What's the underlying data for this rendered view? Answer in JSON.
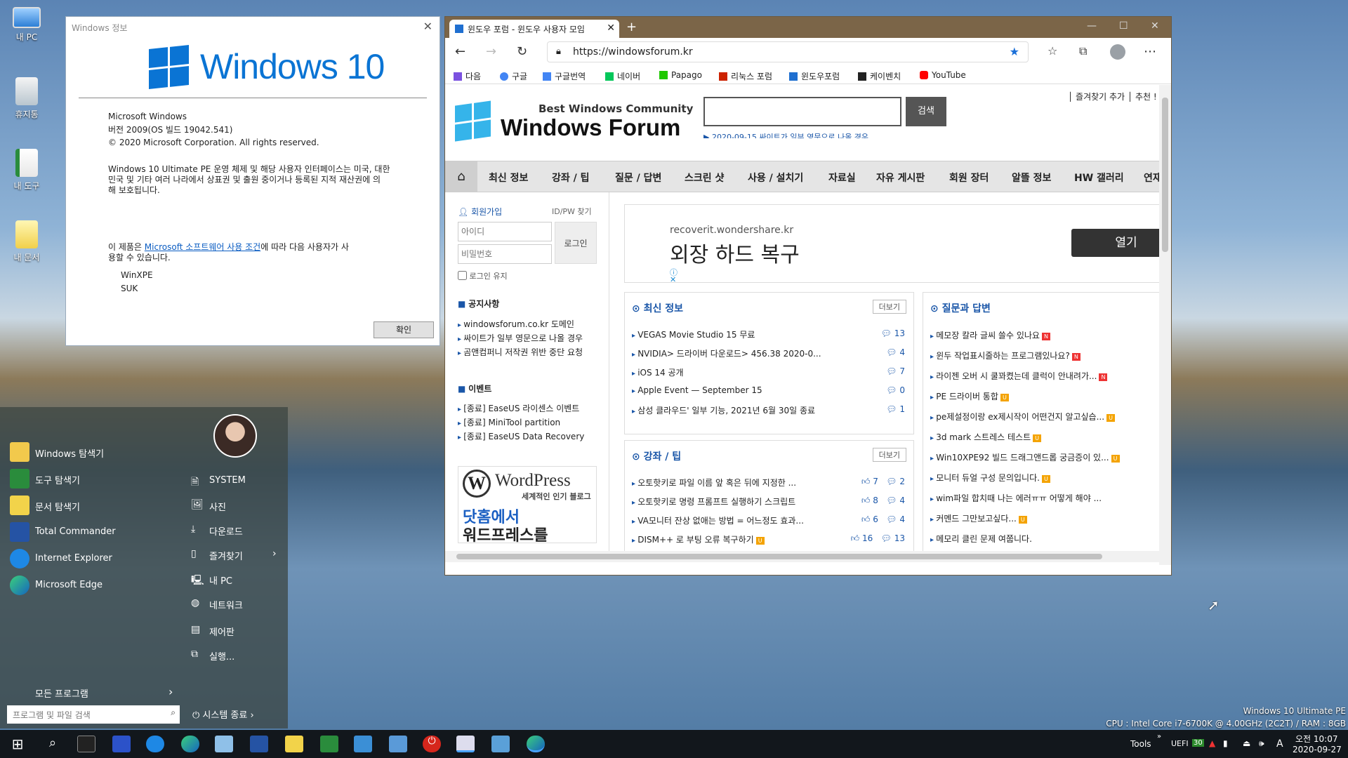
{
  "desktop": {
    "icons": [
      {
        "label": "내 PC",
        "icon": "monitor-icon"
      },
      {
        "label": "휴지통",
        "icon": "recycle-bin-icon"
      },
      {
        "label": "내 도구",
        "icon": "tools-icon"
      },
      {
        "label": "내 문서",
        "icon": "documents-icon"
      }
    ],
    "sysinfo": {
      "line1": "Windows 10 Ultimate PE",
      "line2": "CPU : Intel Core i7-6700K @ 4.00GHz (2C2T) / RAM : 8GB"
    }
  },
  "about": {
    "title": "Windows 정보",
    "logo_text": "Windows 10",
    "product": "Microsoft Windows",
    "version": "버전 2009(OS 빌드 19042.541)",
    "copyright": "© 2020 Microsoft Corporation. All rights reserved.",
    "legal1": " Windows 10 Ultimate PE 운영 체제 및 해당 사용자 인터페이스는 미국, 대한",
    "legal2": "민국 및 기타 여러 나라에서 상표권 및 출원 중이거나 등록된 지적 재산권에 의",
    "legal3": "해 보호됩니다.",
    "license_pre": "이 제품은 ",
    "license_link": "Microsoft 소프트웨어 사용 조건",
    "license_post": "에 따라 다음 사용자가 사",
    "license_line2": "용할 수 있습니다.",
    "user1": "WinXPE",
    "user2": "SUK",
    "ok": "확인"
  },
  "browser": {
    "tab_title": "윈도우 포럼 - 윈도우 사용자 모임",
    "url": "https://windowsforum.kr",
    "bookmarks": [
      {
        "label": "다음",
        "color": "#7b52e0"
      },
      {
        "label": "구글",
        "color": "#4285f4"
      },
      {
        "label": "구글번역",
        "color": "#4285f4"
      },
      {
        "label": "네이버",
        "color": "#03c75a"
      },
      {
        "label": "Papago",
        "color": "#1ec800"
      },
      {
        "label": "리눅스 포럼",
        "color": "#cc2200"
      },
      {
        "label": "윈도우포럼",
        "color": "#1f6fd0"
      },
      {
        "label": "케이벤치",
        "color": "#222222"
      },
      {
        "label": "YouTube",
        "color": "#ff0000"
      }
    ],
    "site": {
      "tagline": "Best Windows Community",
      "brand": "Windows Forum",
      "search_btn": "검색",
      "news_ticker": "▶ 2020-09-15  싸이트가 일부 영문으로 나올 경우",
      "top_links": "│ 즐겨찾기 추가  │ 추천 !",
      "menu": [
        "최신 정보",
        "강좌 / 팁",
        "질문 / 답변",
        "스크린 샷",
        "사용 / 설치기",
        "자료실",
        "자유 게시판",
        "회원 장터",
        "알뜰 정보",
        "HW 갤러리",
        "연재"
      ],
      "login": {
        "join": "회원가입",
        "find": "ID/PW 찾기",
        "id_ph": "아이디",
        "pw_ph": "비밀번호",
        "btn": "로그인",
        "keep": "로그인 유지"
      },
      "notice_title": "공지사항",
      "notices": [
        "windowsforum.co.kr 도메인",
        "싸이트가 일부 영문으로 나올 경우",
        "곰앤컴퍼니 저작권 위반 중단 요청"
      ],
      "event_title": "이벤트",
      "events": [
        "[종료] EaseUS 라이센스 이벤트",
        "[종료] MiniTool partition",
        "[종료] EaseUS Data Recovery"
      ],
      "wp_title": "WordPress",
      "wp_sub": "세계적인 인기 블로그",
      "wp_big1": "닷홈에서",
      "wp_big2": "워드프레스를",
      "ad_domain": "recoverit.wondershare.kr",
      "ad_title": "외장 하드 복구",
      "ad_btn": "열기",
      "more": "더보기",
      "latest_title": "최신 정보",
      "latest": [
        {
          "t": "VEGAS Movie Studio 15 무료",
          "c": "13"
        },
        {
          "t": "NVIDIA> 드라이버 다운로드> 456.38 2020-0...",
          "c": "4"
        },
        {
          "t": "iOS 14 공개",
          "c": "7"
        },
        {
          "t": "Apple Event — September 15",
          "c": "0"
        },
        {
          "t": "삼성 클라우드' 일부 기능, 2021년 6월 30일 종료",
          "c": "1"
        }
      ],
      "tips_title": "강좌 / 팁",
      "tips": [
        {
          "t": "오토핫키로 파일 이름 앞 혹은 뒤에 지정한 ...",
          "l": "7",
          "c": "2"
        },
        {
          "t": "오토핫키로 명령 프롬프트 실행하기 스크립트",
          "l": "8",
          "c": "4"
        },
        {
          "t": "VA모니터 잔상 없애는 방법 = 어느정도 효과...",
          "l": "6",
          "c": "4"
        },
        {
          "t": "DISM++ 로 부팅 오류 복구하기",
          "l": "16",
          "c": "13"
        }
      ],
      "qa_title": "질문과 답변",
      "qa": [
        {
          "t": "메모장 칼라 글씨 쓸수 있나요",
          "b": "N"
        },
        {
          "t": "윈두 작업표시줄하는 프로그램있나요?",
          "b": "N"
        },
        {
          "t": "라이젠 오버 시 쿨꽈켰는데 클럭이 안내려가...",
          "b": "N"
        },
        {
          "t": "PE 드라이버 통합",
          "b": "U"
        },
        {
          "t": "pe제설정이랑 ex제시작이 어떤건지 알고싶습...",
          "b": "U"
        },
        {
          "t": "3d mark 스트레스 테스트",
          "b": "U"
        },
        {
          "t": "Win10XPE92 빌드 드래그앤드롭 궁금증이 있...",
          "b": "U"
        },
        {
          "t": "모니터 듀얼 구성 문의입니다.",
          "b": "U"
        },
        {
          "t": "wim파일 합치때 나는 에러ㅠㅠ 어떻게 해야 ...",
          "b": ""
        },
        {
          "t": "커멘드 그만보고싶다...",
          "b": "U"
        },
        {
          "t": "메모리 클린 문제 여쭙니다.",
          "b": ""
        }
      ]
    }
  },
  "start_menu": {
    "left": [
      "Windows 탐색기",
      "도구 탐색기",
      "문서 탐색기",
      "Total Commander",
      "Internet Explorer",
      "Microsoft Edge"
    ],
    "right": [
      "SYSTEM",
      "사진",
      "다운로드",
      "즐겨찾기",
      "내 PC",
      "네트워크",
      "제어판",
      "실행..."
    ],
    "all_programs": "모든 프로그램",
    "search_ph": "프로그램 및 파일 검색",
    "shutdown": "시스템 종료"
  },
  "taskbar": {
    "tools": "Tools",
    "uefi": "UEFI",
    "badge": "30",
    "ime": "A",
    "time": "오전 10:07",
    "date": "2020-09-27"
  }
}
